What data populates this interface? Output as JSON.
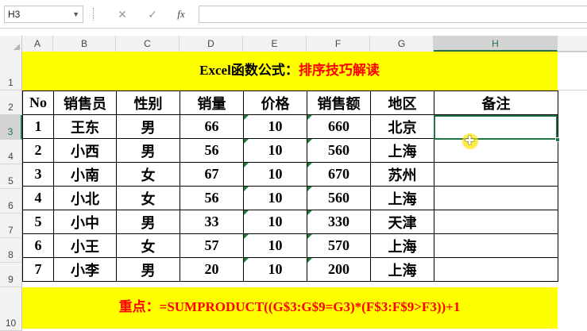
{
  "formula_bar": {
    "name_box": "H3",
    "cancel_icon": "✕",
    "enter_icon": "✓",
    "fx_label": "fx",
    "formula": ""
  },
  "columns": [
    "A",
    "B",
    "C",
    "D",
    "E",
    "F",
    "G",
    "H"
  ],
  "rows": [
    "1",
    "2",
    "3",
    "4",
    "5",
    "6",
    "7",
    "8",
    "9",
    "10"
  ],
  "selected_cell": "H3",
  "title": {
    "part1": "Excel函数公式：",
    "part2": "排序技巧解读"
  },
  "table": {
    "headers": [
      "No",
      "销售员",
      "性别",
      "销量",
      "价格",
      "销售额",
      "地区",
      "备注"
    ],
    "rows": [
      [
        "1",
        "王东",
        "男",
        "66",
        "10",
        "660",
        "北京",
        ""
      ],
      [
        "2",
        "小西",
        "男",
        "56",
        "10",
        "560",
        "上海",
        ""
      ],
      [
        "3",
        "小南",
        "女",
        "67",
        "10",
        "670",
        "苏州",
        ""
      ],
      [
        "4",
        "小北",
        "女",
        "56",
        "10",
        "560",
        "上海",
        ""
      ],
      [
        "5",
        "小中",
        "男",
        "33",
        "10",
        "330",
        "天津",
        ""
      ],
      [
        "6",
        "小王",
        "女",
        "57",
        "10",
        "570",
        "上海",
        ""
      ],
      [
        "7",
        "小李",
        "男",
        "20",
        "10",
        "200",
        "上海",
        ""
      ]
    ]
  },
  "note": "重点：=SUMPRODUCT((G$3:G$9=G3)*(F$3:F$9>F3))+1",
  "colors": {
    "highlight": "#ffff00",
    "accent": "#217346",
    "red_text": "#ff0000"
  }
}
